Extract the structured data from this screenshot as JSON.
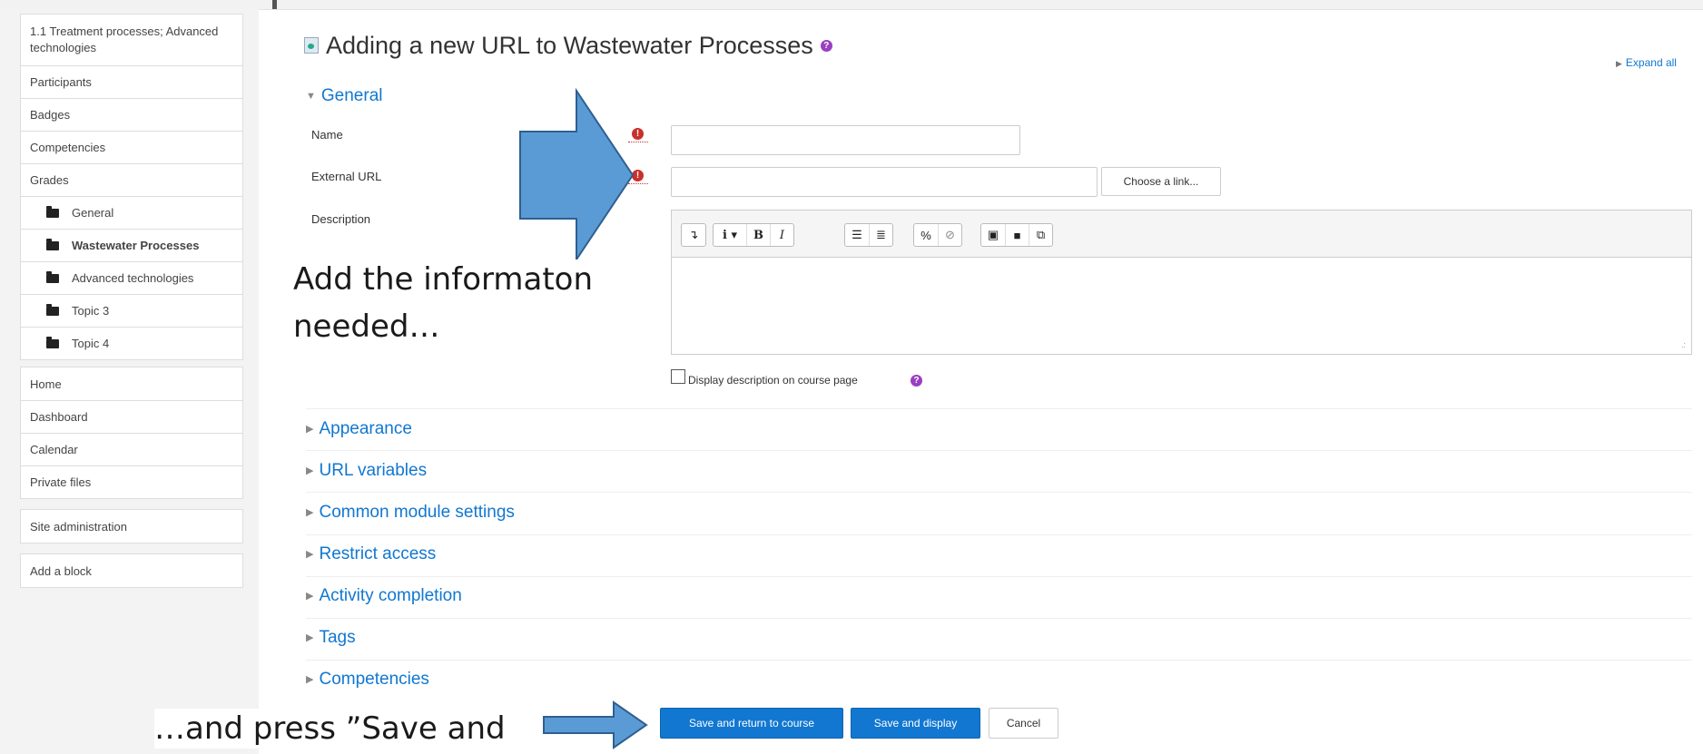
{
  "nav": {
    "course_items": [
      {
        "label": "1.1 Treatment processes; Advanced technologies",
        "kind": "course"
      },
      {
        "label": "Participants",
        "kind": "link"
      },
      {
        "label": "Badges",
        "kind": "link"
      },
      {
        "label": "Competencies",
        "kind": "link"
      },
      {
        "label": "Grades",
        "kind": "link"
      },
      {
        "label": "General",
        "kind": "folder"
      },
      {
        "label": "Wastewater Processes",
        "kind": "folder"
      },
      {
        "label": "Advanced technologies",
        "kind": "folder"
      },
      {
        "label": "Topic 3",
        "kind": "folder"
      },
      {
        "label": "Topic 4",
        "kind": "folder"
      }
    ],
    "site_items": [
      "Home",
      "Dashboard",
      "Calendar",
      "Private files"
    ],
    "site_admin": "Site administration",
    "add_block": "Add a block"
  },
  "page": {
    "title": "Adding a new URL to Wastewater Processes",
    "expand_all": "Expand all"
  },
  "general": {
    "header": "General",
    "name_label": "Name",
    "name_value": "",
    "url_label": "External URL",
    "url_value": "",
    "choose_link": "Choose a link...",
    "description_label": "Description",
    "display_description": "Display description on course page"
  },
  "sections": [
    "Appearance",
    "URL variables",
    "Common module settings",
    "Restrict access",
    "Activity completion",
    "Tags",
    "Competencies"
  ],
  "buttons": {
    "save_return": "Save and return to course",
    "save_display": "Save and display",
    "cancel": "Cancel"
  },
  "annotations": {
    "line1": "Add the informaton",
    "line2": "needed…",
    "press": "…and press ”Save and"
  },
  "colors": {
    "accent": "#1177d1",
    "required": "#c9302c",
    "help": "#9a3fc2",
    "arrow_fill": "#5b9bd5",
    "arrow_stroke": "#2e5f8f"
  }
}
